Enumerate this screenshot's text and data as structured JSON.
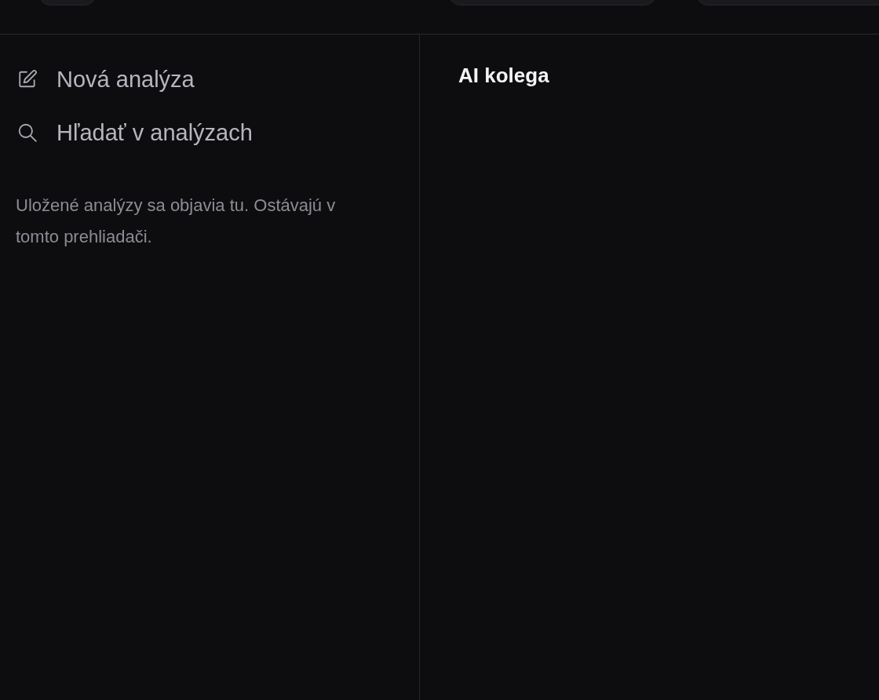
{
  "sidebar": {
    "items": [
      {
        "kind": "new",
        "label": "Nová analýza"
      },
      {
        "kind": "search",
        "label": "Hľadať v analýzach"
      }
    ],
    "empty_note": "Uložené analýzy sa objavia tu. Ostávajú v tomto prehliadači."
  },
  "main": {
    "title": "AI kolega"
  }
}
